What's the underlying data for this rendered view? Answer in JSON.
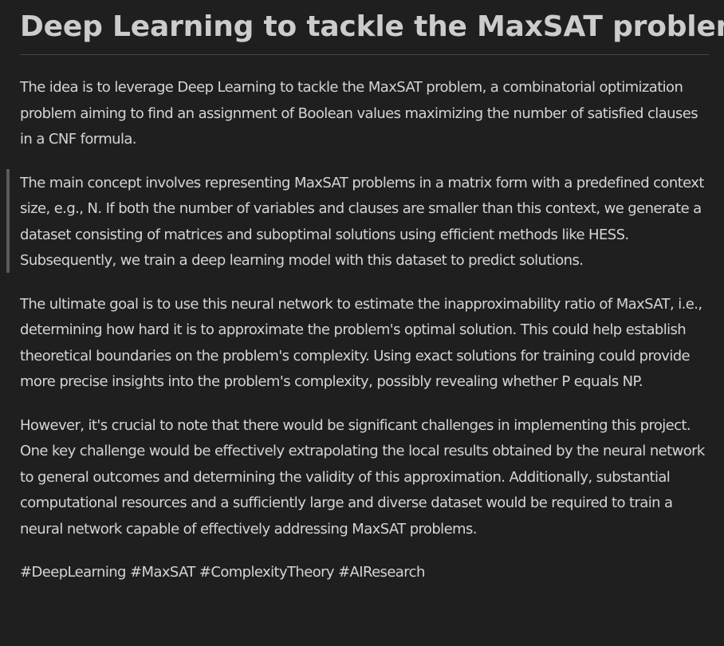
{
  "document": {
    "title": "Deep Learning to tackle the MaxSAT problem",
    "paragraphs": [
      "The idea is to leverage Deep Learning to tackle the MaxSAT problem, a combinatorial optimization problem aiming to find an assignment of Boolean values maximizing the number of satisfied clauses in a CNF formula.",
      "The main concept involves representing MaxSAT problems in a matrix form with a predefined context size, e.g., N. If both the number of variables and clauses are smaller than this context, we generate a dataset consisting of matrices and suboptimal solutions using efficient methods like HESS. Subsequently, we train a deep learning model with this dataset to predict solutions.",
      "The ultimate goal is to use this neural network to estimate the inapproximability ratio of MaxSAT, i.e., determining how hard it is to approximate the problem's optimal solution. This could help establish theoretical boundaries on the problem's complexity. Using exact solutions for training could provide more precise insights into the problem's complexity, possibly revealing whether P equals NP.",
      "However, it's crucial to note that there would be significant challenges in implementing this project. One key challenge would be effectively extrapolating the local results obtained by the neural network to general outcomes and determining the validity of this approximation. Additionally, substantial computational resources and a sufficiently large and diverse dataset would be required to train a neural network capable of effectively addressing MaxSAT problems."
    ],
    "hashtags": "#DeepLearning #MaxSAT #ComplexityTheory #AIResearch"
  },
  "colors": {
    "background": "#1f1f1f",
    "text": "#cccccc",
    "quote_bar": "#5a5a5a",
    "divider": "#454545"
  }
}
